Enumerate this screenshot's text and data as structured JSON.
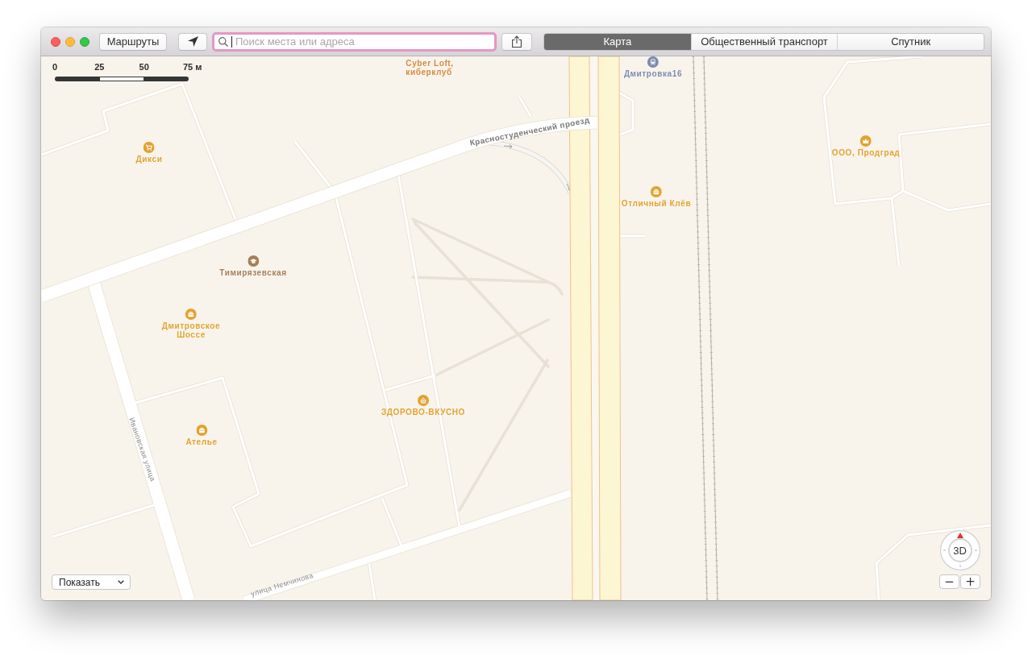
{
  "toolbar": {
    "directions_button": "Маршруты",
    "search": {
      "placeholder": "Поиск места или адреса",
      "focused": true
    },
    "map_modes": [
      {
        "label": "Карта",
        "selected": true
      },
      {
        "label": "Общественный транспорт",
        "selected": false
      },
      {
        "label": "Спутник",
        "selected": false
      }
    ]
  },
  "scale_bar": {
    "labels": [
      "0",
      "25",
      "50",
      "75 м"
    ]
  },
  "map": {
    "places": [
      {
        "name": "Cyber Loft,\nкиберклуб",
        "kind": "text",
        "color": "#d8883a"
      },
      {
        "name": "Дмитровка16",
        "kind": "bus",
        "color": "#7e8bab"
      },
      {
        "name": "Дикси",
        "kind": "cart",
        "color": "#e3a22e"
      },
      {
        "name": "Тимирязевская",
        "kind": "school",
        "color": "#a67f58"
      },
      {
        "name": "Дмитровское\nШоссе",
        "kind": "bag",
        "color": "#e3a22e"
      },
      {
        "name": "Ателье",
        "kind": "bag",
        "color": "#e3a22e"
      },
      {
        "name": "ЗДОРОВО-ВКУСНО",
        "kind": "basket",
        "color": "#e3a22e"
      },
      {
        "name": "Отличный Клёв",
        "kind": "bag",
        "color": "#e3a22e"
      },
      {
        "name": "ООО, Продград",
        "kind": "crown",
        "color": "#e3a22e"
      }
    ],
    "streets": [
      {
        "name": "Красностуденческий проезд"
      },
      {
        "name": "Ивановская улица"
      },
      {
        "name": "улица Немчинова"
      }
    ]
  },
  "show_menu": {
    "label": "Показать"
  },
  "compass": {
    "label": "3D"
  },
  "zoom_controls": [
    "−",
    "+"
  ]
}
